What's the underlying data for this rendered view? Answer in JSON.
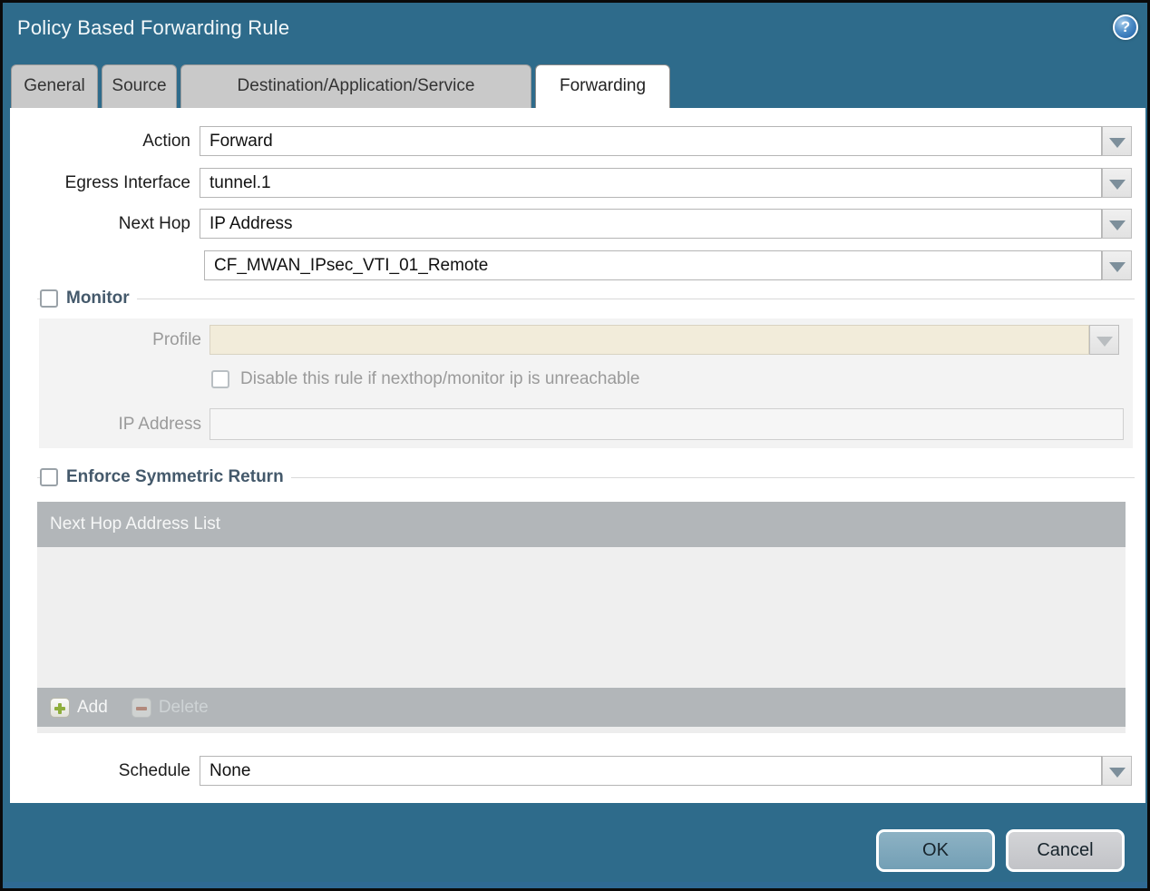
{
  "dialog": {
    "title": "Policy Based Forwarding Rule"
  },
  "tabs": [
    {
      "label": "General",
      "active": false
    },
    {
      "label": "Source",
      "active": false
    },
    {
      "label": "Destination/Application/Service",
      "active": false
    },
    {
      "label": "Forwarding",
      "active": true
    }
  ],
  "form": {
    "action": {
      "label": "Action",
      "value": "Forward"
    },
    "egress_interface": {
      "label": "Egress Interface",
      "value": "tunnel.1"
    },
    "next_hop": {
      "label": "Next Hop",
      "value": "IP Address"
    },
    "next_hop_address": {
      "value": "CF_MWAN_IPsec_VTI_01_Remote"
    },
    "schedule": {
      "label": "Schedule",
      "value": "None"
    }
  },
  "monitor": {
    "title": "Monitor",
    "checked": false,
    "profile": {
      "label": "Profile",
      "value": ""
    },
    "disable_rule": {
      "label": "Disable this rule if nexthop/monitor ip is unreachable",
      "checked": false
    },
    "ip_address": {
      "label": "IP Address",
      "value": ""
    }
  },
  "symmetric_return": {
    "title": "Enforce Symmetric Return",
    "checked": false,
    "list_header": "Next Hop Address List",
    "rows": [],
    "add_label": "Add",
    "delete_label": "Delete"
  },
  "footer": {
    "ok_label": "OK",
    "cancel_label": "Cancel"
  },
  "icons": {
    "help": "help-icon",
    "dropdown": "chevron-down-icon",
    "add": "plus-icon",
    "delete": "minus-icon"
  },
  "colors": {
    "titlebar_bg": "#2e6b8b",
    "active_tab_bg": "#ffffff",
    "inactive_tab_bg": "#c9c9c9",
    "section_title": "#44596b",
    "disabled_field_beige": "#f2ecda",
    "list_header_bg": "#b2b6b9",
    "ok_button_bg": "#7ea9bd",
    "cancel_button_bg": "#c9cacd",
    "add_icon_green": "#8fae3c",
    "delete_icon_red": "#a8705f"
  }
}
